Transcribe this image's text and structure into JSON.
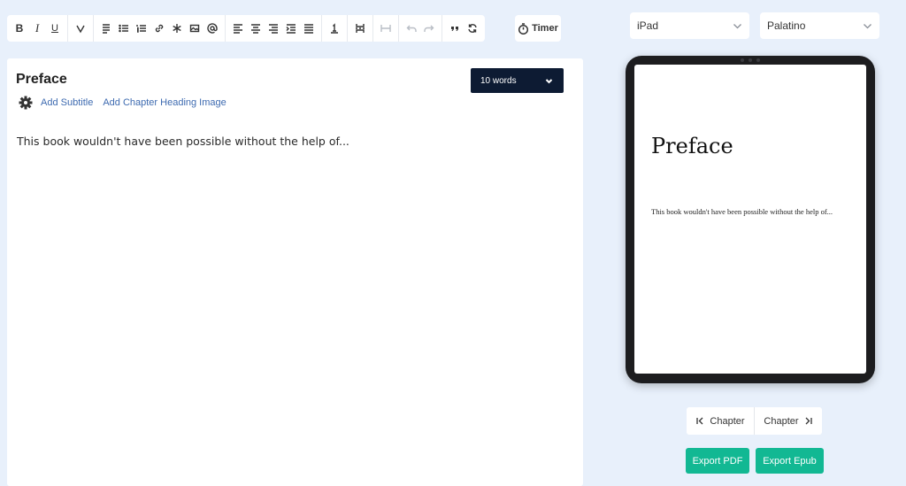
{
  "toolbar": {
    "bold_label": "B",
    "italic_label": "I",
    "underline_label": "U",
    "timer_label": "Timer"
  },
  "editor": {
    "chapter_title": "Preface",
    "add_subtitle": "Add Subtitle",
    "add_heading_image": "Add Chapter Heading Image",
    "word_count": "10 words",
    "body_text": "This book wouldn't have been possible without the help of..."
  },
  "preview": {
    "device_select": "iPad",
    "font_select": "Palatino",
    "title": "Preface",
    "body_text": "This book wouldn't have been possible without the help of..."
  },
  "navigation": {
    "prev_label": "Chapter",
    "next_label": "Chapter"
  },
  "export": {
    "pdf_label": "Export PDF",
    "epub_label": "Export Epub"
  },
  "colors": {
    "background": "#e8f0fb",
    "word_count_bg": "#0d1b33",
    "export_bg": "#12b893",
    "link": "#3d6ab0"
  }
}
